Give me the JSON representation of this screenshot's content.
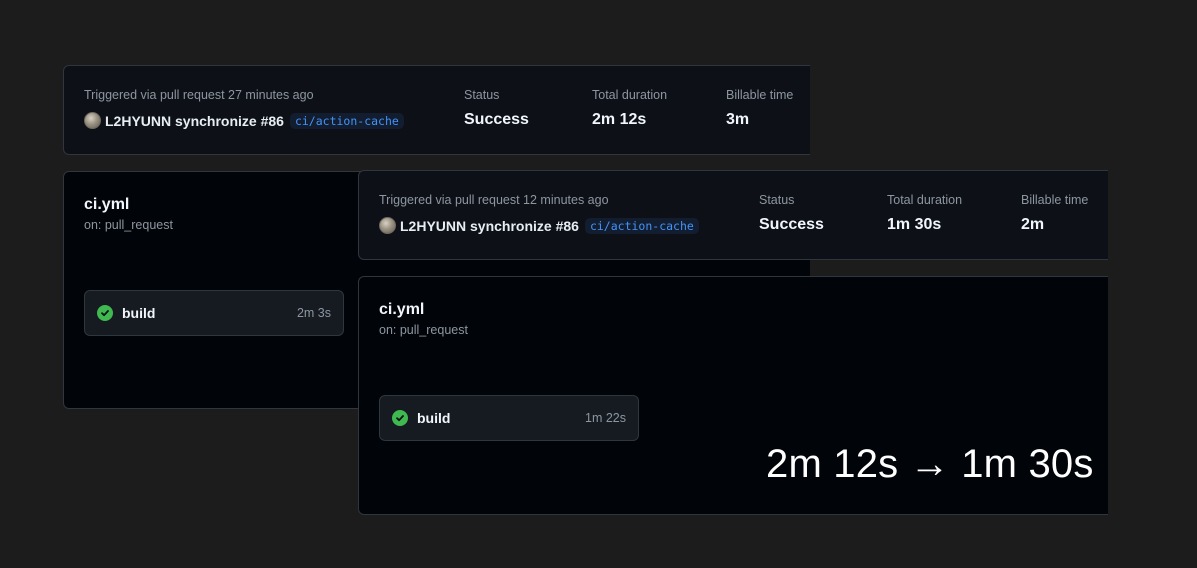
{
  "back_run": {
    "trigger_text": "Triggered via pull request 27 minutes ago",
    "actor_text": "L2HYUNN synchronize #86",
    "branch": "ci/action-cache",
    "status_label": "Status",
    "status_value": "Success",
    "total_label": "Total duration",
    "total_value": "2m 12s",
    "billable_label": "Billable time",
    "billable_value": "3m",
    "workflow_name": "ci.yml",
    "workflow_trigger": "on: pull_request",
    "job_name": "build",
    "job_duration": "2m 3s"
  },
  "front_run": {
    "trigger_text": "Triggered via pull request 12 minutes ago",
    "actor_text": "L2HYUNN synchronize #86",
    "branch": "ci/action-cache",
    "status_label": "Status",
    "status_value": "Success",
    "total_label": "Total duration",
    "total_value": "1m 30s",
    "billable_label": "Billable time",
    "billable_value": "2m",
    "workflow_name": "ci.yml",
    "workflow_trigger": "on: pull_request",
    "job_name": "build",
    "job_duration": "1m 22s"
  },
  "caption": "2m 12s → 1m 30s",
  "colors": {
    "background": "#1c1c1d",
    "panel": "#0d1117",
    "graph_panel": "#010409",
    "border": "#30363d",
    "success": "#3fb950",
    "branch_link": "#4493f8"
  },
  "icons": {
    "avatar": "avatar",
    "job_status": "check-circle-icon"
  }
}
